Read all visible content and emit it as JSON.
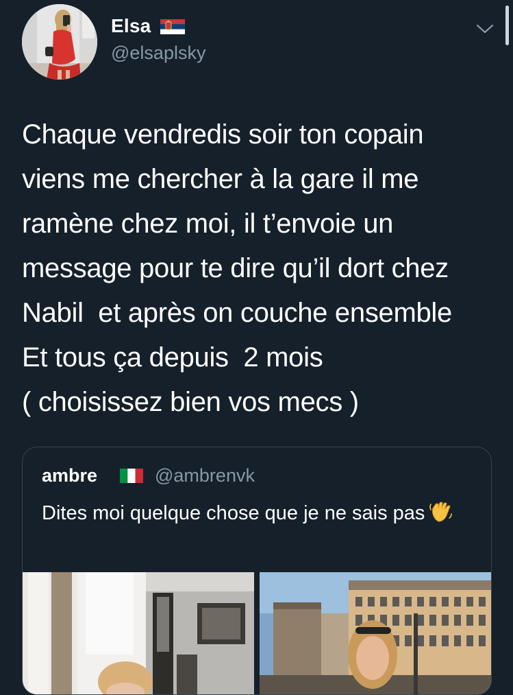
{
  "tweet": {
    "author": {
      "name": "Elsa",
      "handle": "@elsaplsky",
      "flag": "serbia-flag-icon",
      "avatar": "profile-photo-woman-red-dress"
    },
    "text": "Chaque vendredis soir ton copain\nviens me chercher à la gare il me\nramène chez moi, il t’envoie un\nmessage pour te dire qu’il dort chez\nNabil  et après on couche ensemble\nEt tous ça depuis  2 mois\n( choisissez bien vos mecs )",
    "menu_icon": "chevron-down-icon"
  },
  "quoted_tweet": {
    "author": {
      "name": "ambre",
      "handle": "@ambrenvk",
      "flag": "italy-flag-icon"
    },
    "text": "Dites moi quelque chose que je ne sais pas",
    "emoji": "waving-hand-icon",
    "media": [
      "photo-woman-interior",
      "photo-woman-city-street"
    ]
  },
  "colors": {
    "background": "#15202b",
    "secondary_text": "#8899a6",
    "border": "#38444d"
  }
}
